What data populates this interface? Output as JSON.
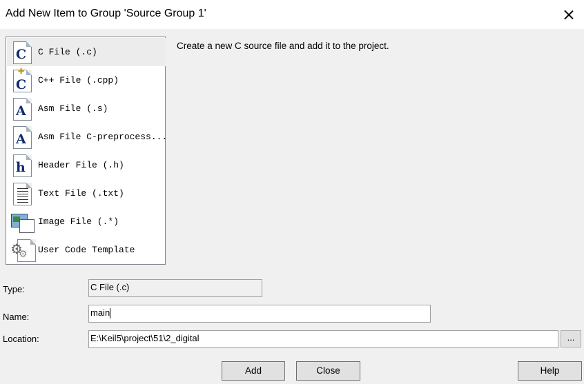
{
  "window": {
    "title": "Add New Item to Group 'Source Group 1'",
    "close_icon": "close-icon"
  },
  "file_types": [
    {
      "label": "C File (.c)",
      "icon": "c-file-icon",
      "glyph": "C",
      "selected": true
    },
    {
      "label": "C++ File (.cpp)",
      "icon": "cpp-file-icon",
      "glyph": "C",
      "selected": false
    },
    {
      "label": "Asm File (.s)",
      "icon": "asm-file-icon",
      "glyph": "A",
      "selected": false
    },
    {
      "label": "Asm File C-preprocess...",
      "icon": "asm-preprocess-file-icon",
      "glyph": "A",
      "selected": false
    },
    {
      "label": "Header File (.h)",
      "icon": "header-file-icon",
      "glyph": "h",
      "selected": false
    },
    {
      "label": "Text File (.txt)",
      "icon": "text-file-icon",
      "glyph": "",
      "selected": false
    },
    {
      "label": "Image File (.*)",
      "icon": "image-file-icon",
      "glyph": "",
      "selected": false
    },
    {
      "label": "User Code Template",
      "icon": "code-template-icon",
      "glyph": "",
      "selected": false
    }
  ],
  "description": "Create a new C source file and add it to the project.",
  "form": {
    "type_label": "Type:",
    "type_value": "C File (.c)",
    "name_label": "Name:",
    "name_value": "main",
    "location_label": "Location:",
    "location_value": "E:\\Keil5\\project\\51\\2_digital",
    "browse_label": "..."
  },
  "buttons": {
    "add": "Add",
    "close": "Close",
    "help": "Help"
  }
}
